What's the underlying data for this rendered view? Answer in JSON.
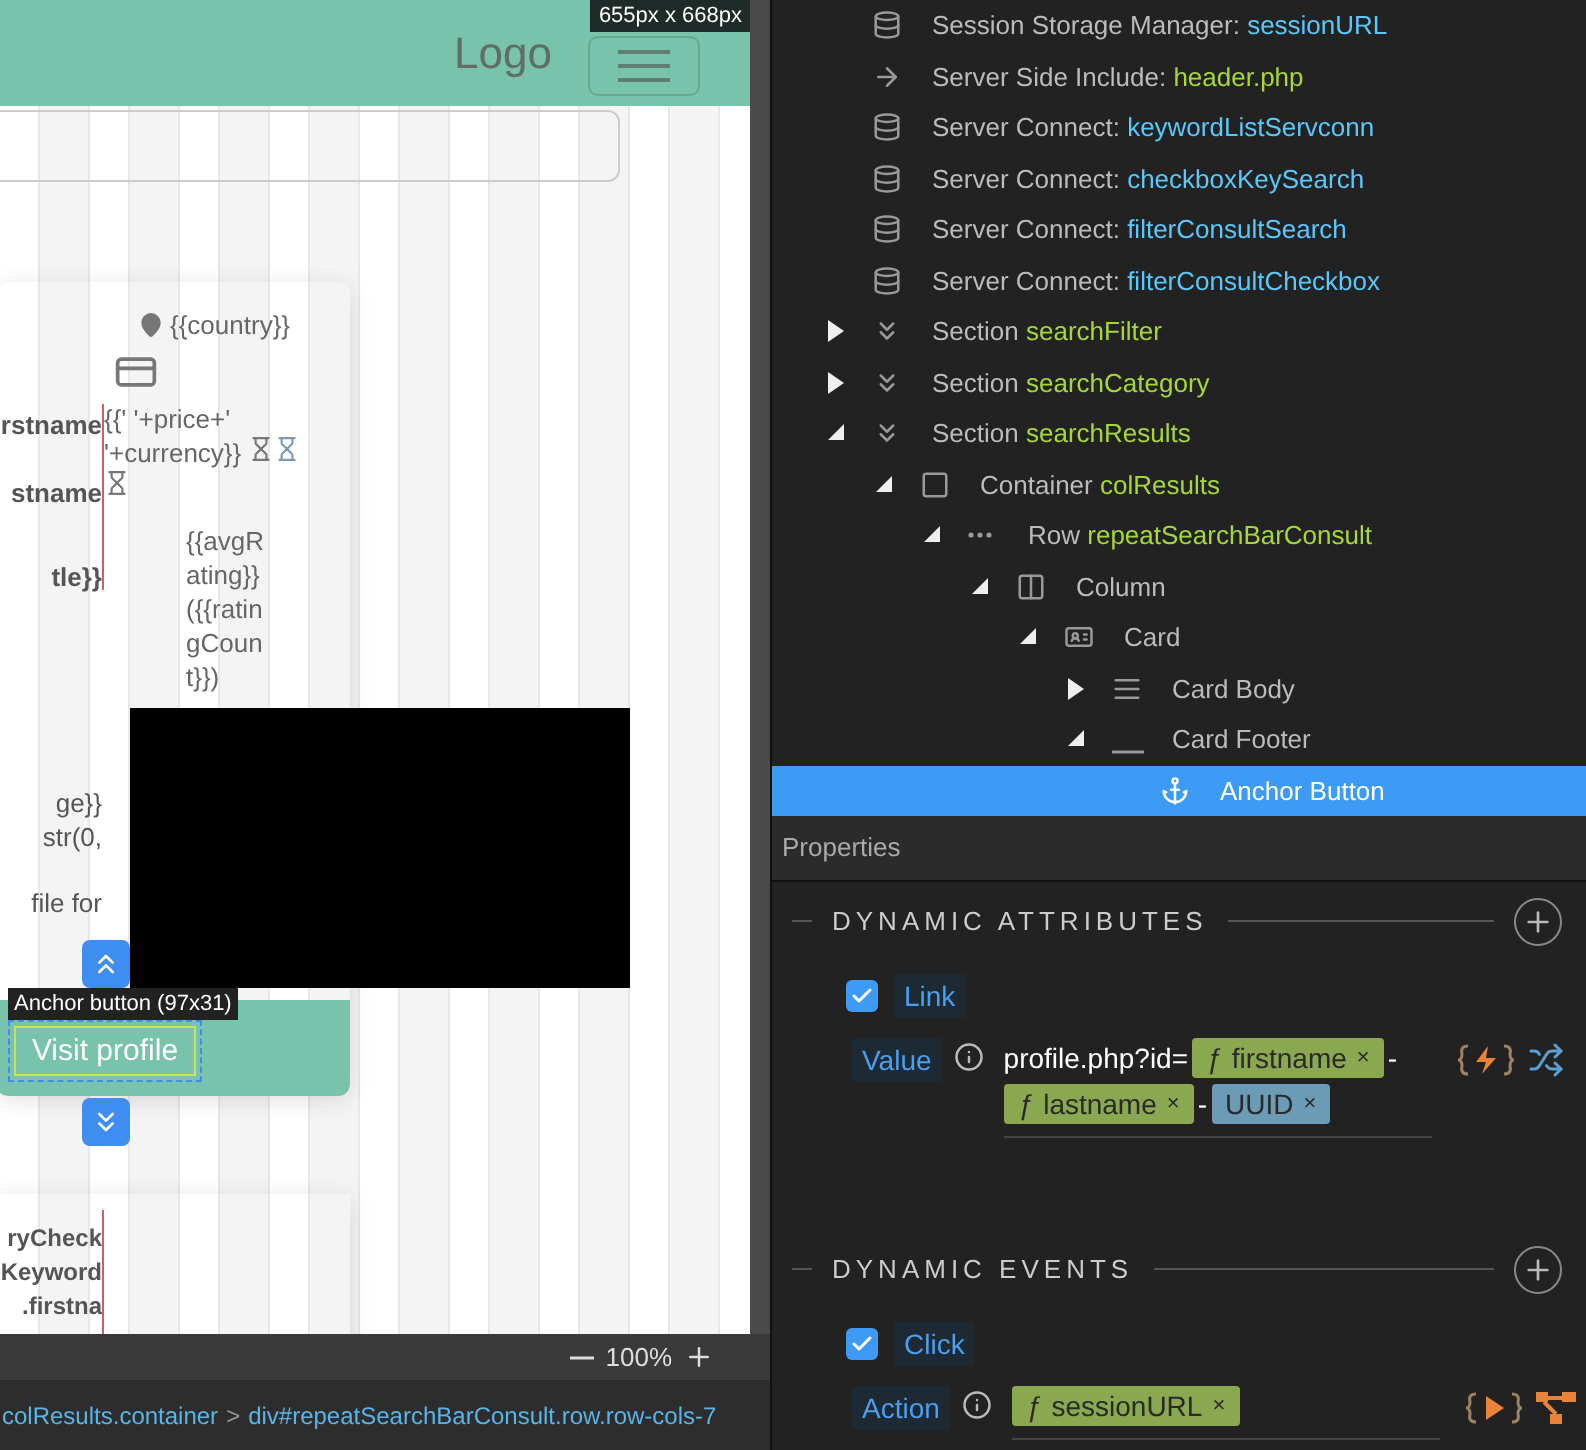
{
  "canvas": {
    "size_label": "655px x 668px",
    "logo": "Logo",
    "card": {
      "fields": [
        {
          "text": "rstname",
          "bold": true
        },
        {
          "text": "stname",
          "bold": true
        },
        {
          "text": "tle}}",
          "bold": true
        },
        {
          "text": "ge}}",
          "bold": false
        },
        {
          "text": "str(0,",
          "bold": false
        },
        {
          "text": "file for",
          "bold": false
        }
      ],
      "country": "{{country}}",
      "price": "{{' '+price+' '+currency}}",
      "rating": "{{avgRating}}({{ratingCount}})",
      "tooltip": "Anchor button (97x31)",
      "button": "Visit profile"
    },
    "next_card": {
      "fields": [
        "ryCheck",
        "Keyword",
        ".firstna"
      ]
    },
    "zoom": "100%",
    "breadcrumb": [
      {
        "text": "colResults.container"
      },
      {
        "text": ">"
      },
      {
        "text": "div#repeatSearchBarConsult.row.row-cols-7"
      }
    ]
  },
  "tree": [
    {
      "kind": "database",
      "label": "Session Storage Manager:",
      "name": "sessionURL",
      "selected": false
    },
    {
      "kind": "include",
      "label": "Server Side Include:",
      "name": "header.php",
      "selected": false
    },
    {
      "kind": "database",
      "label": "Server Connect:",
      "name": "keywordListServconn",
      "selected": false
    },
    {
      "kind": "database",
      "label": "Server Connect:",
      "name": "checkboxKeySearch",
      "selected": false
    },
    {
      "kind": "database",
      "label": "Server Connect:",
      "name": "filterConsultSearch",
      "selected": false
    },
    {
      "kind": "database",
      "label": "Server Connect:",
      "name": "filterConsultCheckbox",
      "selected": false
    },
    {
      "kind": "section",
      "label": "Section",
      "name": "searchFilter",
      "expanded": false,
      "selected": false
    },
    {
      "kind": "section",
      "label": "Section",
      "name": "searchCategory",
      "expanded": false,
      "selected": false
    },
    {
      "kind": "section",
      "label": "Section",
      "name": "searchResults",
      "expanded": true,
      "selected": false,
      "children": [
        {
          "kind": "container",
          "label": "Container",
          "name": "colResults",
          "expanded": true,
          "selected": false,
          "children": [
            {
              "kind": "row",
              "label": "Row",
              "name": "repeatSearchBarConsult",
              "expanded": true,
              "selected": false,
              "children": [
                {
                  "kind": "column",
                  "label": "Column",
                  "expanded": true,
                  "selected": false,
                  "children": [
                    {
                      "kind": "card",
                      "label": "Card",
                      "expanded": true,
                      "selected": false,
                      "children": [
                        {
                          "kind": "card-body",
                          "label": "Card Body",
                          "expanded": false,
                          "selected": false
                        },
                        {
                          "kind": "card-footer",
                          "label": "Card Footer",
                          "expanded": true,
                          "selected": false,
                          "children": [
                            {
                              "kind": "anchor",
                              "label": "Anchor Button",
                              "selected": true
                            }
                          ]
                        }
                      ]
                    }
                  ]
                }
              ]
            }
          ]
        }
      ]
    }
  ],
  "properties": {
    "title": "Properties",
    "sections": [
      {
        "title": "DYNAMIC ATTRIBUTES",
        "checked": true,
        "item": "Link",
        "field_label": "Value",
        "kind": "bind",
        "parts": [
          {
            "kind": "text",
            "text": "profile.php?id="
          },
          {
            "kind": "function",
            "symbol": "ƒ",
            "text": "firstname",
            "remove": "×"
          },
          {
            "kind": "text",
            "text": "-"
          },
          {
            "kind": "function",
            "symbol": "ƒ",
            "text": "lastname",
            "remove": "×"
          },
          {
            "kind": "text",
            "text": "-"
          },
          {
            "kind": "variable",
            "text": "UUID",
            "remove": "×"
          }
        ]
      },
      {
        "title": "DYNAMIC EVENTS",
        "checked": true,
        "item": "Click",
        "field_label": "Action",
        "kind": "flow",
        "parts": [
          {
            "kind": "function",
            "symbol": "ƒ",
            "text": "sessionURL",
            "remove": "×"
          }
        ]
      }
    ]
  }
}
